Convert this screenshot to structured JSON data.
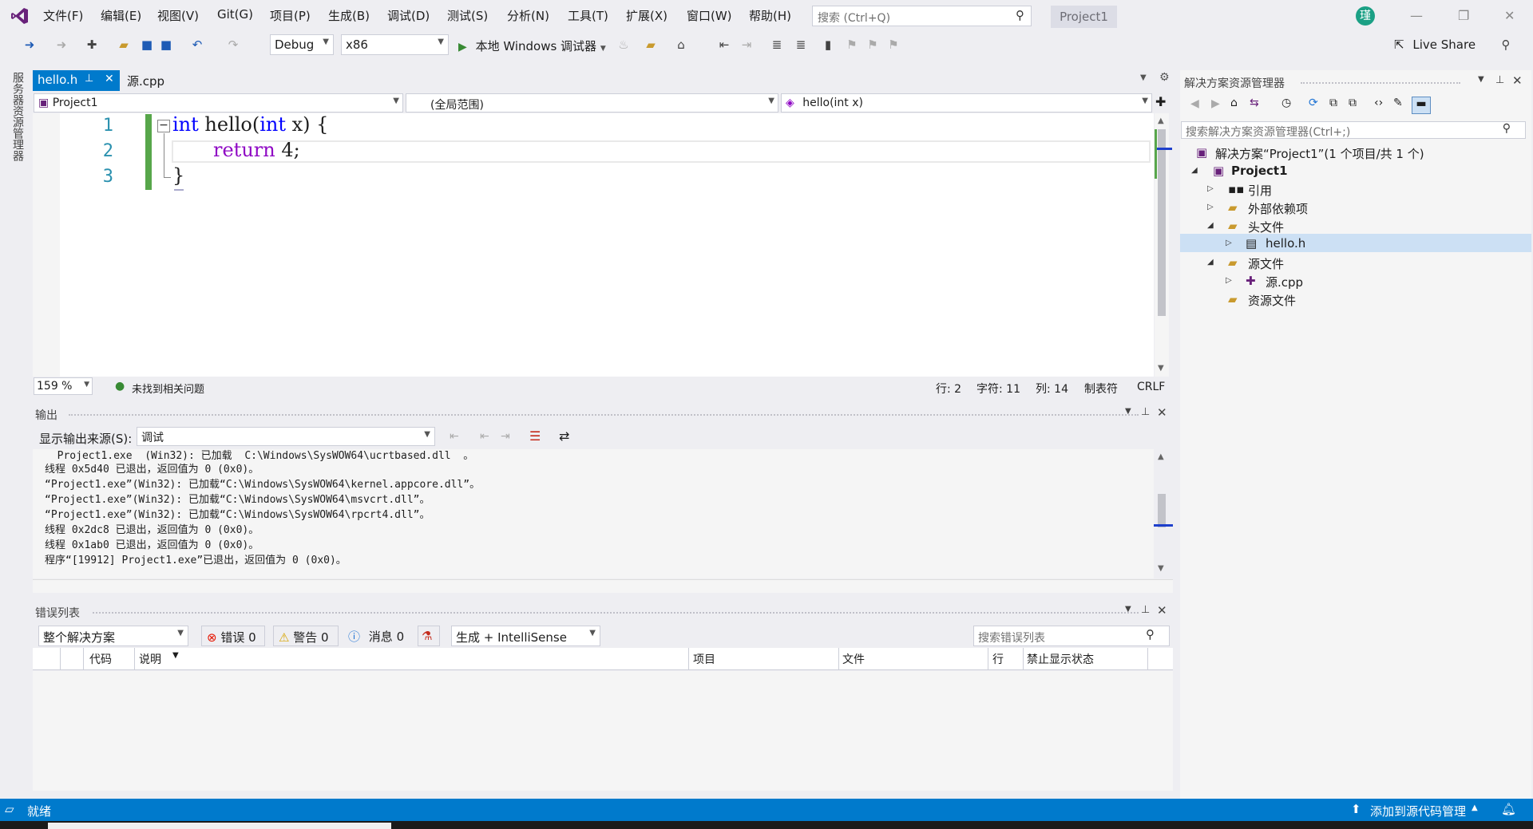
{
  "menu": {
    "items": [
      "文件(F)",
      "编辑(E)",
      "视图(V)",
      "Git(G)",
      "项目(P)",
      "生成(B)",
      "调试(D)",
      "测试(S)",
      "分析(N)",
      "工具(T)",
      "扩展(X)",
      "窗口(W)",
      "帮助(H)"
    ],
    "search_placeholder": "搜索 (Ctrl+Q)",
    "project_badge": "Project1",
    "avatar_letter": "瑾"
  },
  "toolbar": {
    "config": "Debug",
    "platform": "x86",
    "run_label": "本地 Windows 调试器",
    "live_share": "Live Share"
  },
  "side_strip": {
    "label": "服务器资源管理器"
  },
  "editor": {
    "tabs": [
      {
        "label": "hello.h",
        "active": true
      },
      {
        "label": "源.cpp",
        "active": false
      }
    ],
    "nav": {
      "project": "Project1",
      "scope": "(全局范围)",
      "member": "hello(int x)"
    },
    "lines": [
      {
        "num": "1"
      },
      {
        "num": "2"
      },
      {
        "num": "3"
      }
    ],
    "code": {
      "l1_kw1": "int",
      "l1_name": " hello(",
      "l1_kw2": "int",
      "l1_rest": " x) {",
      "l2_kw": "return",
      "l2_rest": " 4;",
      "l3": "}"
    },
    "status": {
      "zoom": "159 %",
      "issues": "未找到相关问题",
      "row": "行: 2",
      "char": "字符: 11",
      "col": "列: 14",
      "tab": "制表符",
      "eol": "CRLF"
    }
  },
  "output": {
    "title": "输出",
    "source_label": "显示输出来源(S):",
    "source_value": "调试",
    "lines": [
      "  Project1.exe  (Win32): 已加载  C:\\Windows\\SysWOW64\\ucrtbased.dll  。",
      "线程 0x5d40 已退出，返回值为 0 (0x0)。",
      "“Project1.exe”(Win32): 已加载“C:\\Windows\\SysWOW64\\kernel.appcore.dll”。",
      "“Project1.exe”(Win32): 已加载“C:\\Windows\\SysWOW64\\msvcrt.dll”。",
      "“Project1.exe”(Win32): 已加载“C:\\Windows\\SysWOW64\\rpcrt4.dll”。",
      "线程 0x2dc8 已退出，返回值为 0 (0x0)。",
      "线程 0x1ab0 已退出，返回值为 0 (0x0)。",
      "程序“[19912] Project1.exe”已退出，返回值为 0 (0x0)。"
    ]
  },
  "errors": {
    "title": "错误列表",
    "scope": "整个解决方案",
    "errors_btn": "错误 0",
    "warnings_btn": "警告 0",
    "messages_btn": "消息 0",
    "build_filter": "生成 + IntelliSense",
    "search_placeholder": "搜索错误列表",
    "columns": [
      "代码",
      "说明",
      "项目",
      "文件",
      "行",
      "禁止显示状态"
    ]
  },
  "solution_explorer": {
    "title": "解决方案资源管理器",
    "search_placeholder": "搜索解决方案资源管理器(Ctrl+;)",
    "tree": [
      {
        "label": "解决方案“Project1”(1 个项目/共 1 个)"
      },
      {
        "label": "Project1"
      },
      {
        "label": "引用"
      },
      {
        "label": "外部依赖项"
      },
      {
        "label": "头文件"
      },
      {
        "label": "hello.h"
      },
      {
        "label": "源文件"
      },
      {
        "label": "源.cpp"
      },
      {
        "label": "资源文件"
      }
    ]
  },
  "status_bar": {
    "ready": "就绪",
    "source_control": "添加到源代码管理"
  },
  "colors": {
    "accent": "#007acc",
    "keyword": "#0000ff",
    "keyword_flow": "#8f08c4",
    "line_number": "#2b91af",
    "change_bar": "#57a64a"
  }
}
